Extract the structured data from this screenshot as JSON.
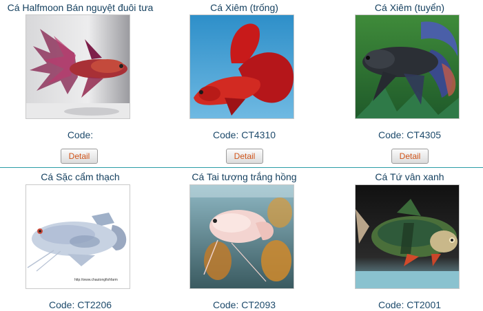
{
  "products": [
    {
      "title": "Cá Halfmoon Bán nguyệt đuôi tưa",
      "code_label": "Code:",
      "button": "Detail",
      "image": "halfmoon-betta-photo"
    },
    {
      "title": "Cá Xiêm (trống)",
      "code_label": "Code: CT4310",
      "button": "Detail",
      "image": "red-betta-photo"
    },
    {
      "title": "Cá Xiêm (tuyển)",
      "code_label": "Code: CT4305",
      "button": "Detail",
      "image": "dark-betta-photo"
    },
    {
      "title": "Cá Sặc cẩm thạch",
      "code_label": "Code: CT2206",
      "image": "marble-gourami-photo",
      "watermark": "http://www.chautongfishfarm"
    },
    {
      "title": "Cá Tai tượng trắng hồng",
      "code_label": "Code: CT2093",
      "image": "pink-gourami-photo"
    },
    {
      "title": "Cá Tứ vân xanh",
      "code_label": "Code: CT2001",
      "image": "green-tiger-barb-photo"
    }
  ],
  "colors": {
    "title_text": "#15405f",
    "code_text": "#1d4a6b",
    "button_text": "#d0541a",
    "divider": "#2a9da6"
  }
}
